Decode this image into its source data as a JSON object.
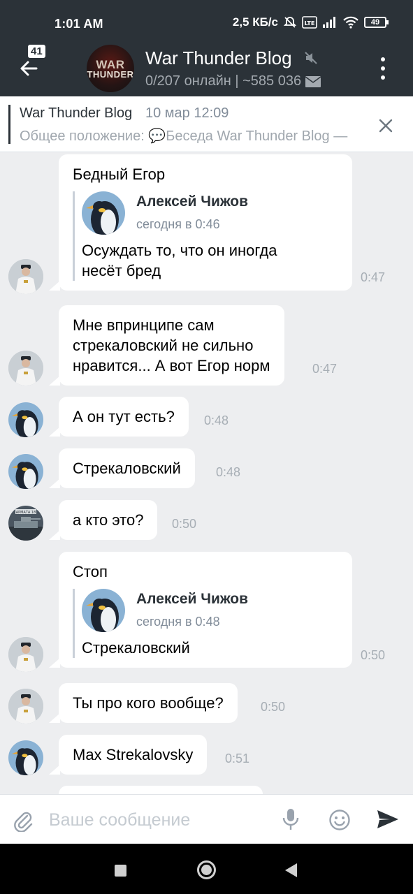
{
  "status_bar": {
    "time": "1:01 AM",
    "speed": "2,5 КБ/с",
    "battery": "49",
    "icons": [
      "alarm-off-icon",
      "volte-icon",
      "signal-icon",
      "wifi-icon",
      "battery-icon"
    ]
  },
  "header": {
    "unread_badge": "41",
    "title": "War Thunder Blog",
    "subtitle": "0/207 онлайн | ~585 036",
    "avatar_logo_top": "WAR",
    "avatar_logo_bottom": "THUNDER",
    "icons": [
      "back-arrow-icon",
      "mute-icon",
      "mail-icon",
      "more-vertical-icon"
    ]
  },
  "pinned": {
    "name": "War Thunder Blog",
    "date": "10 мар 12:09",
    "text": "Общее положение:  💬Беседа War Thunder Blog —"
  },
  "messages": [
    {
      "text": "Бедный Егор",
      "time": "0:47",
      "avatar": "officer",
      "quote": {
        "name": "Алексей Чижов",
        "time": "сегодня в 0:46",
        "text": "Осуждать то, что он иногда\nнесёт бред"
      }
    },
    {
      "text": "Мне впринципе сам\nстрекаловский не сильно\nнравится... А вот Егор норм",
      "time": "0:47",
      "avatar": "officer"
    },
    {
      "text": "А он тут есть?",
      "time": "0:48",
      "avatar": "penguin"
    },
    {
      "text": "Стрекаловский",
      "time": "0:48",
      "avatar": "penguin"
    },
    {
      "text": "а кто это?",
      "time": "0:50",
      "avatar": "tank",
      "avatar_caption": "АРМАТА 18"
    },
    {
      "text": "Стоп",
      "time": "0:50",
      "avatar": "officer",
      "quote": {
        "name": "Алексей Чижов",
        "time": "сегодня в 0:48",
        "text": "Стрекаловский"
      }
    },
    {
      "text": "Ты про кого вообще?",
      "time": "0:50",
      "avatar": "officer"
    },
    {
      "text": "Max Strekalovsky",
      "time": "0:51",
      "avatar": "penguin"
    }
  ],
  "composer": {
    "placeholder": "Ваше сообщение",
    "icons": [
      "paperclip-icon",
      "microphone-icon",
      "emoji-icon",
      "send-icon"
    ]
  },
  "colors": {
    "header_bg": "#2b3238",
    "chat_bg": "#edeef0",
    "bubble_bg": "#ffffff",
    "secondary_text": "#818c99"
  }
}
